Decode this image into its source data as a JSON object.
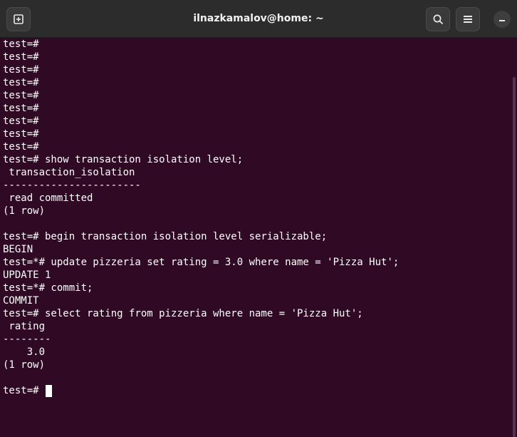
{
  "window": {
    "title": "ilnazkamalov@home: ~"
  },
  "icons": {
    "new_tab": "new-tab-icon",
    "search": "search-icon",
    "menu": "hamburger-menu-icon",
    "minimize": "minimize-icon"
  },
  "terminal": {
    "lines": [
      "test=#",
      "test=#",
      "test=#",
      "test=#",
      "test=#",
      "test=#",
      "test=#",
      "test=#",
      "test=#",
      "test=# show transaction isolation level;",
      " transaction_isolation",
      "-----------------------",
      " read committed",
      "(1 row)",
      "",
      "test=# begin transaction isolation level serializable;",
      "BEGIN",
      "test=*# update pizzeria set rating = 3.0 where name = 'Pizza Hut';",
      "UPDATE 1",
      "test=*# commit;",
      "COMMIT",
      "test=# select rating from pizzeria where name = 'Pizza Hut';",
      " rating",
      "--------",
      "    3.0",
      "(1 row)",
      ""
    ],
    "prompt": "test=# "
  },
  "colors": {
    "terminal_bg": "#300a24",
    "titlebar_bg": "#2c2c2c",
    "text": "#ffffff"
  }
}
